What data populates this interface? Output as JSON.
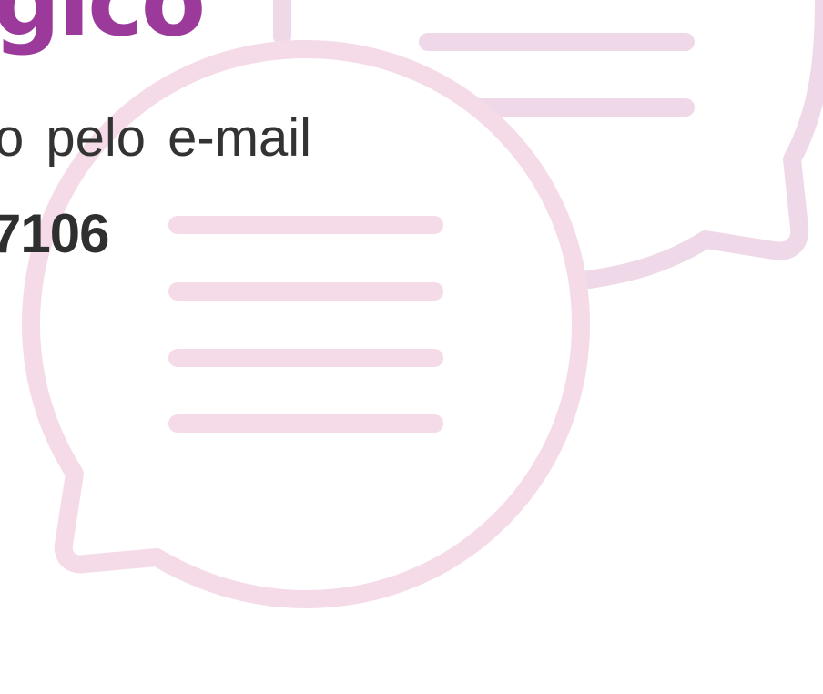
{
  "title": "gico",
  "contact_text": "o  pelo  e-mail",
  "phone_fragment": "7106",
  "colors": {
    "title": "#9b3a9b",
    "body_text": "#333333",
    "bubble_front": "#f5dbe7",
    "bubble_back": "#efd9e8"
  },
  "icons": [
    "speech-bubble-icon",
    "speech-bubble-icon"
  ]
}
